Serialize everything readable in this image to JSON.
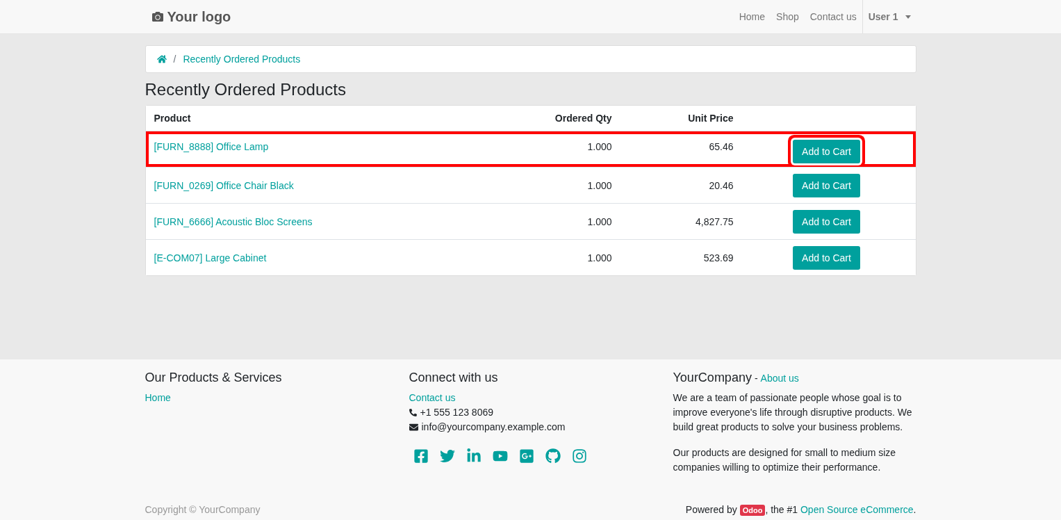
{
  "header": {
    "logo": "Your logo",
    "nav": [
      {
        "label": "Home"
      },
      {
        "label": "Shop"
      },
      {
        "label": "Contact us"
      }
    ],
    "user": "User 1"
  },
  "breadcrumb": {
    "separator": "/",
    "current": "Recently Ordered Products"
  },
  "title": "Recently Ordered Products",
  "table": {
    "columns": [
      "Product",
      "Ordered Qty",
      "Unit Price"
    ],
    "rows": [
      {
        "product": "[FURN_8888] Office Lamp",
        "qty": "1.000",
        "price": "65.46",
        "action": "Add to Cart",
        "highlighted": true
      },
      {
        "product": "[FURN_0269] Office Chair Black",
        "qty": "1.000",
        "price": "20.46",
        "action": "Add to Cart",
        "highlighted": false
      },
      {
        "product": "[FURN_6666] Acoustic Bloc Screens",
        "qty": "1.000",
        "price": "4,827.75",
        "action": "Add to Cart",
        "highlighted": false
      },
      {
        "product": "[E-COM07] Large Cabinet",
        "qty": "1.000",
        "price": "523.69",
        "action": "Add to Cart",
        "highlighted": false
      }
    ]
  },
  "footer": {
    "products": {
      "title": "Our Products & Services",
      "links": [
        "Home"
      ]
    },
    "connect": {
      "title": "Connect with us",
      "link": "Contact us",
      "phone": "+1 555 123 8069",
      "email": "info@yourcompany.example.com"
    },
    "about": {
      "title": "YourCompany",
      "separator": "-",
      "link": "About us",
      "paragraphs": [
        "We are a team of passionate people whose goal is to improve everyone's life through disruptive products. We build great products to solve your business problems.",
        "Our products are designed for small to medium size companies willing to optimize their performance."
      ]
    },
    "copyright": "Copyright © YourCompany",
    "powered": {
      "before": "Powered by",
      "badge": "Odoo",
      "middle": ", the #1",
      "link": "Open Source eCommerce",
      "after": "."
    }
  }
}
